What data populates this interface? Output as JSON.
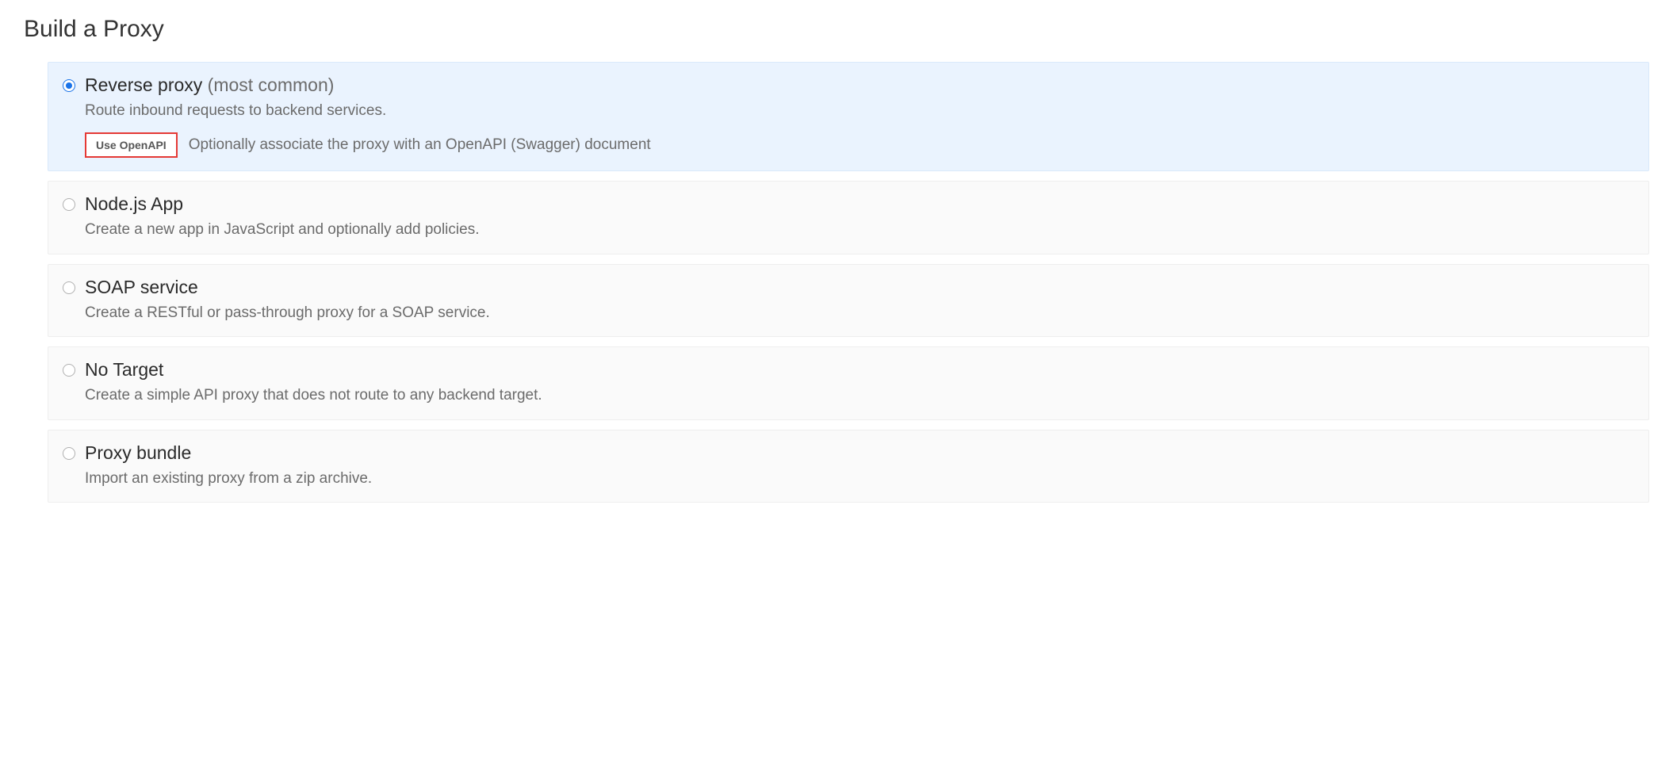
{
  "page": {
    "title": "Build a Proxy"
  },
  "options": [
    {
      "title": "Reverse proxy",
      "qualifier": "(most common)",
      "description": "Route inbound requests to backend services.",
      "selected": true,
      "extra": {
        "button_label": "Use OpenAPI",
        "description": "Optionally associate the proxy with an OpenAPI (Swagger) document"
      }
    },
    {
      "title": "Node.js App",
      "qualifier": "",
      "description": "Create a new app in JavaScript and optionally add policies.",
      "selected": false
    },
    {
      "title": "SOAP service",
      "qualifier": "",
      "description": "Create a RESTful or pass-through proxy for a SOAP service.",
      "selected": false
    },
    {
      "title": "No Target",
      "qualifier": "",
      "description": "Create a simple API proxy that does not route to any backend target.",
      "selected": false
    },
    {
      "title": "Proxy bundle",
      "qualifier": "",
      "description": "Import an existing proxy from a zip archive.",
      "selected": false
    }
  ]
}
